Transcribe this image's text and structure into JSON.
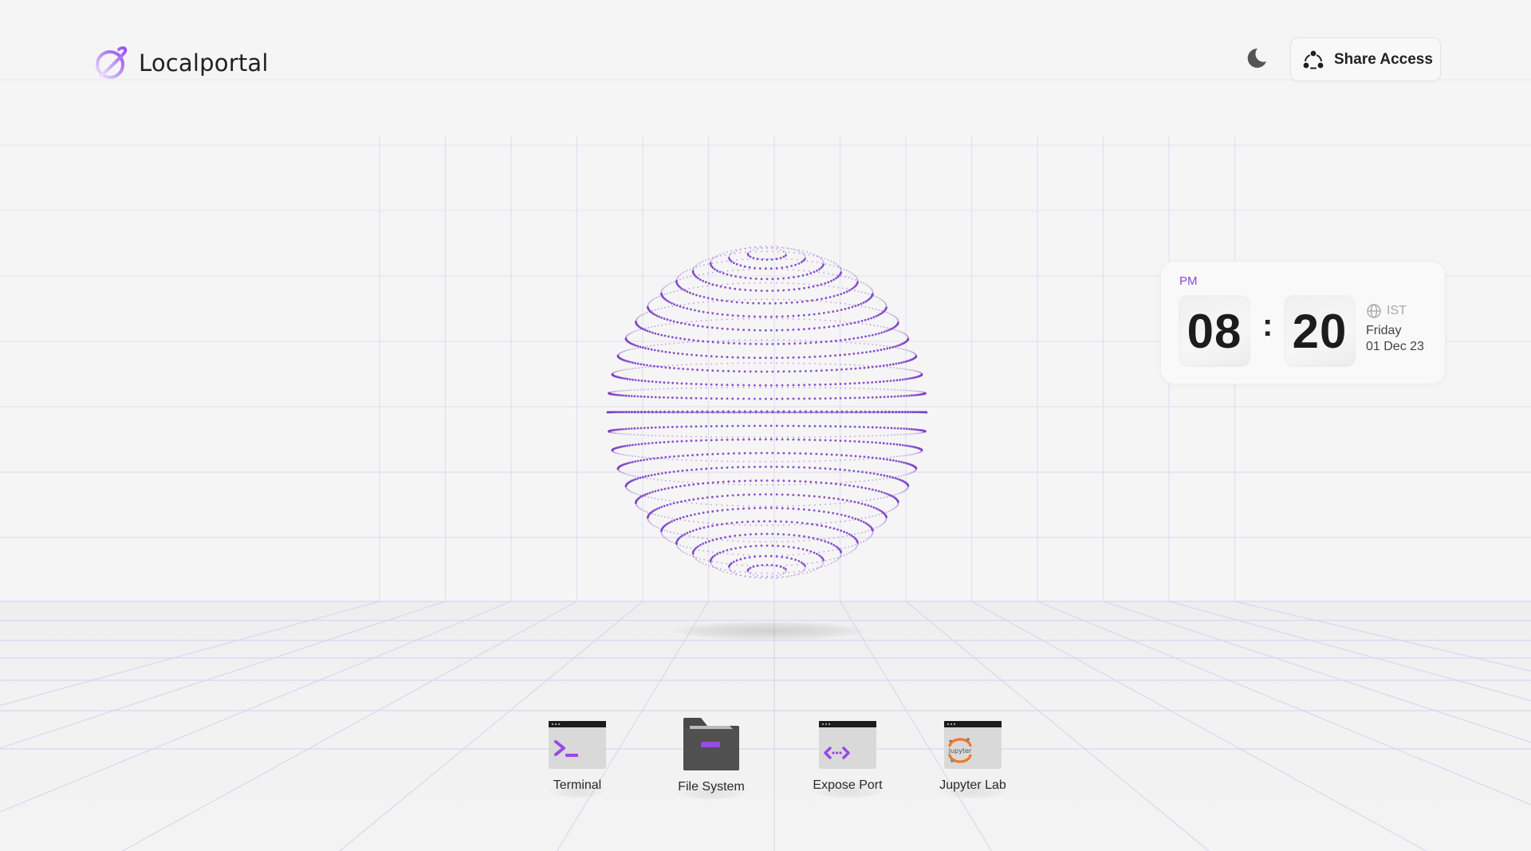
{
  "app": {
    "name": "Localportal",
    "brand_color": "#8e44d8"
  },
  "header": {
    "theme_toggle_icon": "moon-icon",
    "share_button": {
      "label": "Share Access",
      "icon": "share-nodes-icon"
    }
  },
  "clock": {
    "ampm": "PM",
    "hours": "08",
    "separator": ":",
    "minutes": "20",
    "timezone": "IST",
    "timezone_icon": "globe-icon",
    "day": "Friday",
    "date": "01 Dec 23"
  },
  "hero": {
    "graphic": "dotted-wireframe-sphere",
    "accent_color": "#7a3fc9",
    "grid_color": "#d9d2f0"
  },
  "dock": {
    "items": [
      {
        "label": "Terminal",
        "icon": "terminal-icon"
      },
      {
        "label": "File System",
        "icon": "folder-icon"
      },
      {
        "label": "Expose Port",
        "icon": "expose-port-icon"
      },
      {
        "label": "Jupyter Lab",
        "icon": "jupyter-icon"
      }
    ]
  }
}
